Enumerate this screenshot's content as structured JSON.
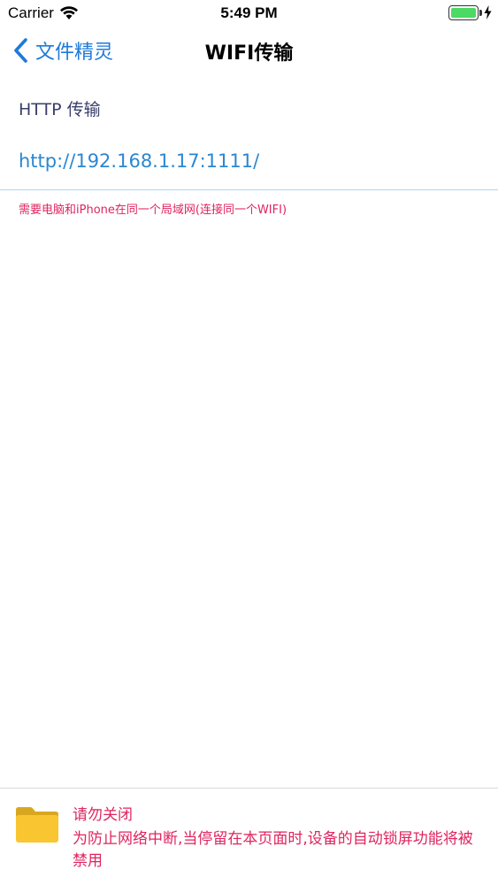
{
  "status_bar": {
    "carrier": "Carrier",
    "time": "5:49 PM",
    "battery_level": 1.0,
    "battery_color": "#4cd964",
    "charging": true,
    "icons": [
      "wifi-icon",
      "battery-icon",
      "charging-bolt-icon"
    ]
  },
  "nav": {
    "back_label": "文件精灵",
    "title": "WIFI传输",
    "back_icon": "chevron-left-icon",
    "accent": "#1e7ad9"
  },
  "main": {
    "section_label": "HTTP 传输",
    "url": "http://192.168.1.17:1111/",
    "hint": "需要电脑和iPhone在同一个局域网(连接同一个WIFI)",
    "hint_color": "#e0245e"
  },
  "notice": {
    "icon": "folder-icon",
    "title": "请勿关闭",
    "body": "为防止网络中断,当停留在本页面时,设备的自动锁屏功能将被禁用"
  }
}
